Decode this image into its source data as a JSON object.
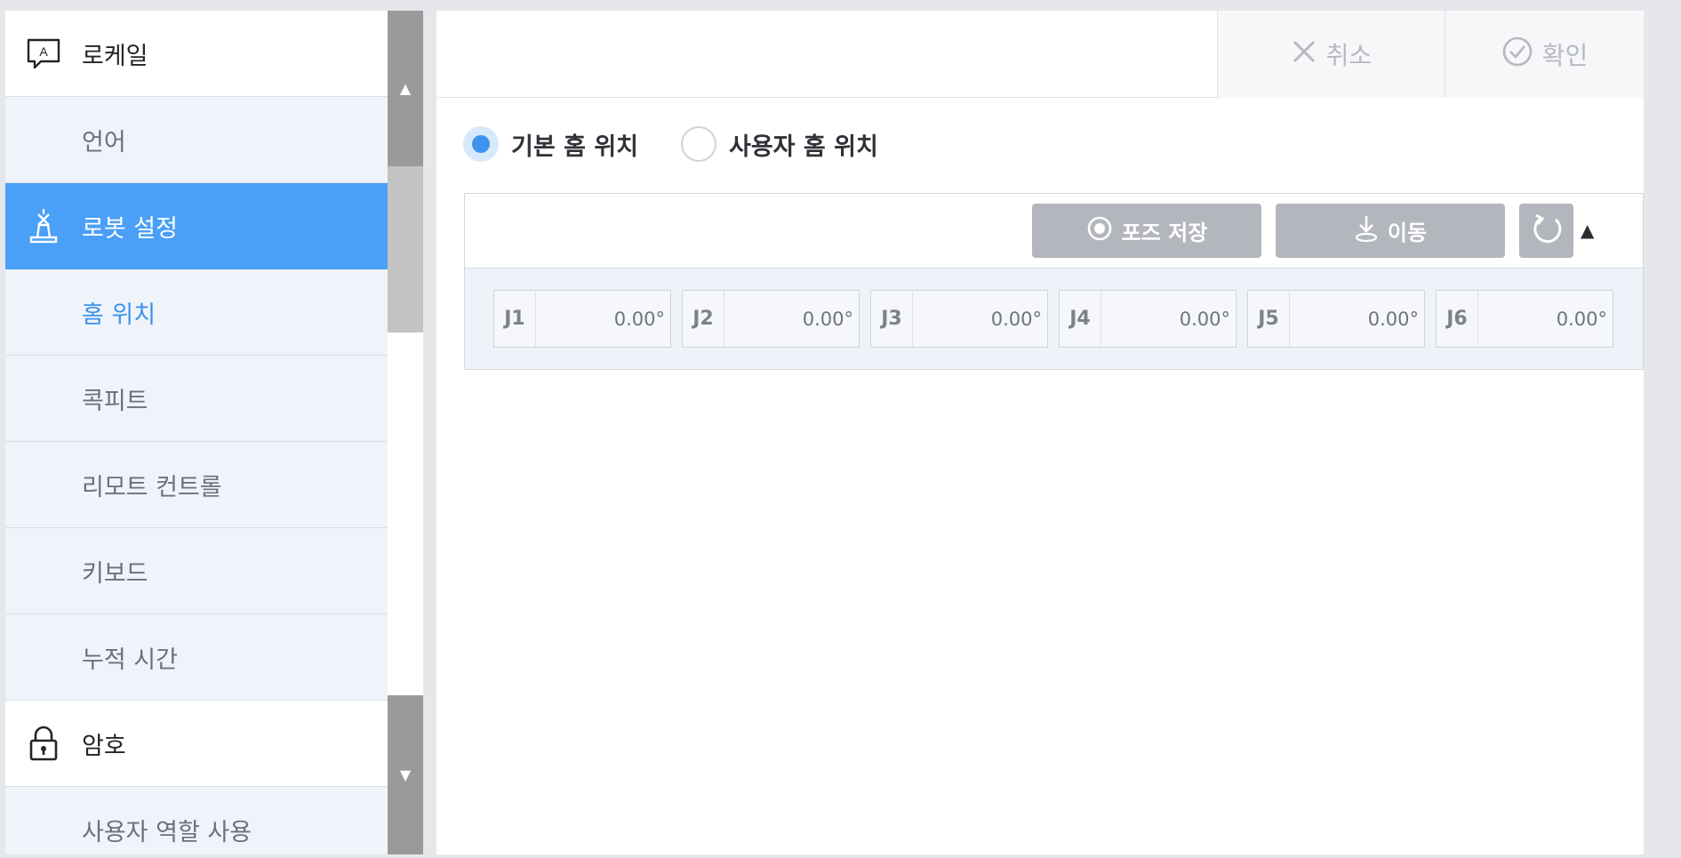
{
  "sidebar": {
    "items": [
      {
        "label": "로케일",
        "type": "header",
        "icon": "locale-icon"
      },
      {
        "label": "언어",
        "type": "child"
      },
      {
        "label": "로봇 설정",
        "type": "active",
        "icon": "robot-icon"
      },
      {
        "label": "홈 위치",
        "type": "selected-child"
      },
      {
        "label": "콕피트",
        "type": "child"
      },
      {
        "label": "리모트 컨트롤",
        "type": "child"
      },
      {
        "label": "키보드",
        "type": "child"
      },
      {
        "label": "누적 시간",
        "type": "child"
      },
      {
        "label": "암호",
        "type": "header",
        "icon": "lock-icon"
      },
      {
        "label": "사용자 역할 사용",
        "type": "child"
      }
    ]
  },
  "topbar": {
    "cancel_label": "취소",
    "confirm_label": "확인"
  },
  "home_position": {
    "options": [
      {
        "label": "기본 홈 위치",
        "selected": true
      },
      {
        "label": "사용자 홈 위치",
        "selected": false
      }
    ]
  },
  "pose_toolbar": {
    "save_pose_label": "포즈 저장",
    "move_label": "이동"
  },
  "joints": [
    {
      "label": "J1",
      "value": "0.00°"
    },
    {
      "label": "J2",
      "value": "0.00°"
    },
    {
      "label": "J3",
      "value": "0.00°"
    },
    {
      "label": "J4",
      "value": "0.00°"
    },
    {
      "label": "J5",
      "value": "0.00°"
    },
    {
      "label": "J6",
      "value": "0.00°"
    }
  ],
  "colors": {
    "accent": "#4a9ff6",
    "button_disabled": "#b3b6bc",
    "sidebar_child_bg": "#eff4fb"
  }
}
